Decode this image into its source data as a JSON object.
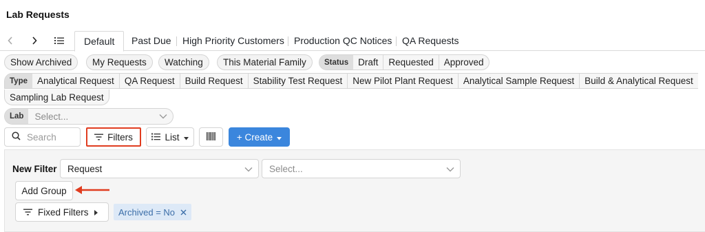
{
  "page": {
    "title": "Lab Requests"
  },
  "tabs": [
    {
      "label": "Default",
      "active": true
    },
    {
      "label": "Past Due"
    },
    {
      "label": "High Priority Customers"
    },
    {
      "label": "Production QC Notices"
    },
    {
      "label": "QA Requests"
    }
  ],
  "quick_filters": {
    "show_archived": "Show Archived",
    "my_requests": "My Requests",
    "watching": "Watching",
    "this_material_family": "This Material Family"
  },
  "status_filter": {
    "label": "Status",
    "options": [
      "Draft",
      "Requested",
      "Approved"
    ]
  },
  "type_filter": {
    "label": "Type",
    "options": [
      "Analytical Request",
      "QA Request",
      "Build Request",
      "Stability Test Request",
      "New Pilot Plant Request",
      "Analytical Sample Request",
      "Build & Analytical Request",
      "Sampling Lab Request"
    ]
  },
  "lab_filter": {
    "label": "Lab",
    "placeholder": "Select..."
  },
  "toolbar": {
    "search_placeholder": "Search",
    "filters_label": "Filters",
    "list_label": "List",
    "create_label": "+ Create"
  },
  "filter_panel": {
    "new_filter_label": "New Filter",
    "field_value": "Request",
    "operator_placeholder": "Select...",
    "add_group_label": "Add Group",
    "fixed_filters_label": "Fixed Filters",
    "active_chip": "Archived = No"
  },
  "colors": {
    "highlight_border": "#e03c1f",
    "create_button": "#3b86dd",
    "chip_background": "#dde9f7",
    "chip_text": "#3c6ea8"
  }
}
